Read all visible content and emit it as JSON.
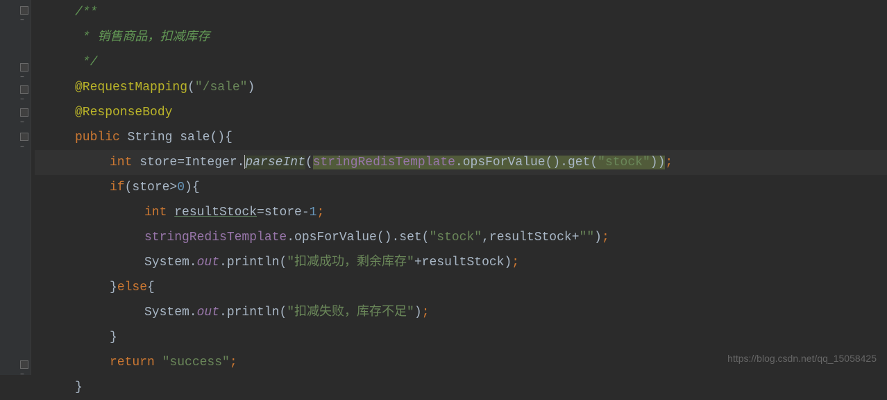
{
  "lines": {
    "l1": "/**",
    "l2": " * 销售商品，扣减库存",
    "l3": " */",
    "l4_annotation": "@RequestMapping",
    "l4_paren_open": "(",
    "l4_string": "\"/sale\"",
    "l4_paren_close": ")",
    "l5_annotation": "@ResponseBody",
    "l6_keyword": "public ",
    "l6_type": "String ",
    "l6_method": "sale",
    "l6_end": "(){",
    "l7_keyword": "int ",
    "l7_var": "store=Integer.",
    "l7_method": "parseInt",
    "l7_paren": "(",
    "l7_field": "stringRedisTemplate",
    "l7_call": ".opsForValue().get(",
    "l7_string": "\"stock\"",
    "l7_end": "))",
    "l7_semi": ";",
    "l8_keyword": "if",
    "l8_cond": "(store>",
    "l8_num": "0",
    "l8_end": "){",
    "l9_keyword": "int ",
    "l9_var": "resultStock",
    "l9_assign": "=store-",
    "l9_num": "1",
    "l9_semi": ";",
    "l10_field": "stringRedisTemplate",
    "l10_call": ".opsForValue().set(",
    "l10_str1": "\"stock\"",
    "l10_mid": ",resultStock+",
    "l10_str2": "\"\"",
    "l10_end": ")",
    "l10_semi": ";",
    "l11_sys": "System.",
    "l11_out": "out",
    "l11_print": ".println(",
    "l11_str": "\"扣减成功，剩余库存\"",
    "l11_end": "+resultStock)",
    "l11_semi": ";",
    "l12_brace": "}",
    "l12_else": "else",
    "l12_brace2": "{",
    "l13_sys": "System.",
    "l13_out": "out",
    "l13_print": ".println(",
    "l13_str": "\"扣减失败，库存不足\"",
    "l13_end": ")",
    "l13_semi": ";",
    "l14": "}",
    "l15_keyword": "return ",
    "l15_str": "\"success\"",
    "l15_semi": ";",
    "l16": "}"
  },
  "watermark": "https://blog.csdn.net/qq_15058425"
}
